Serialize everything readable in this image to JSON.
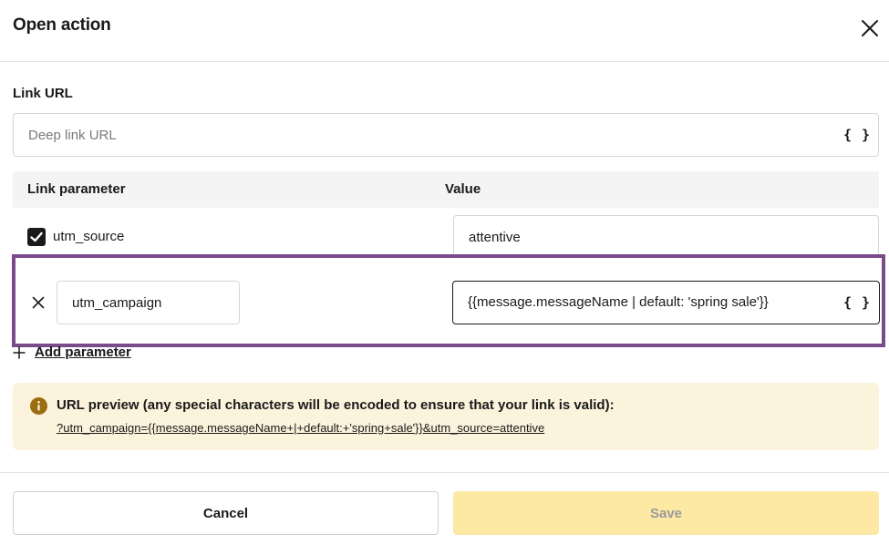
{
  "dialog": {
    "title": "Open action"
  },
  "link_url": {
    "label": "Link URL",
    "placeholder": "Deep link URL",
    "value": "",
    "braces": "{}"
  },
  "table": {
    "header_param": "Link parameter",
    "header_value": "Value",
    "rows": [
      {
        "param": "utm_source",
        "value": "attentive",
        "checked": true
      },
      {
        "param": "utm_campaign",
        "value": "{{message.messageName | default: 'spring sale'}}",
        "braces": "{}"
      }
    ]
  },
  "add_parameter": {
    "label": "Add parameter"
  },
  "preview": {
    "title": "URL preview (any special characters will be encoded to ensure that your link is valid):",
    "link": "?utm_campaign={{message.messageName+|+default:+'spring+sale'}}&utm_source=attentive"
  },
  "footer": {
    "cancel": "Cancel",
    "save": "Save"
  },
  "colors": {
    "highlight_border": "#7b4a8b",
    "preview_bg": "#fbf3dc",
    "info_icon": "#9a6d0f",
    "save_bg": "#fde9a3"
  }
}
